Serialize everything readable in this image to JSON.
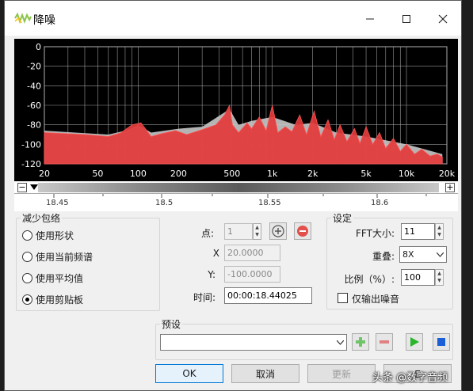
{
  "window": {
    "title": "降噪"
  },
  "plot": {
    "y_ticks": [
      "0",
      "-20",
      "-40",
      "-60",
      "-80",
      "-100",
      "-120"
    ],
    "x_ticks": [
      "20",
      "50",
      "100",
      "200",
      "500",
      "1k",
      "2k",
      "5k",
      "10k",
      "20k"
    ],
    "curve_color": "#e33a3a",
    "profile_color": "#c8c8c8"
  },
  "timeline": {
    "minus_label": "−",
    "plus_label": "+",
    "ticks": [
      "18.45",
      "18.5",
      "18.55",
      "18.6"
    ]
  },
  "reduce_group": {
    "title": "减少包络",
    "options": [
      {
        "label": "使用形状",
        "selected": false
      },
      {
        "label": "使用当前频谱",
        "selected": false
      },
      {
        "label": "使用平均值",
        "selected": false
      },
      {
        "label": "使用剪贴板",
        "selected": true
      }
    ]
  },
  "point": {
    "point_label": "点:",
    "point_value": "1",
    "x_label": "X",
    "x_value": "20.0000",
    "y_label": "Y:",
    "y_value": "-100.0000",
    "time_label": "时间:",
    "time_value": "00:00:18.44025"
  },
  "settings": {
    "title": "设定",
    "fft_label": "FFT大小:",
    "fft_value": "11",
    "overlap_label": "重叠:",
    "overlap_value": "8X",
    "ratio_label": "比例（%）:",
    "ratio_value": "100",
    "noise_only_label": "仅输出噪音"
  },
  "preset": {
    "title": "预设",
    "value": ""
  },
  "buttons": {
    "ok": "OK",
    "cancel": "取消",
    "update": "更新",
    "extra": "Ｅ"
  },
  "watermark": "头条 @数字音频"
}
